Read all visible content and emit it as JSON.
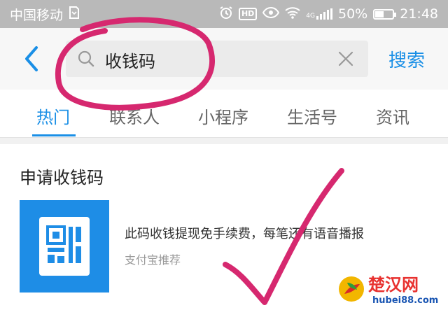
{
  "status_bar": {
    "carrier": "中国移动",
    "battery_percent": "50%",
    "battery_level": 0.5,
    "time": "21:48",
    "hd_badge": "HD",
    "network": "4G"
  },
  "header": {
    "search_value": "收钱码",
    "search_button_label": "搜索"
  },
  "tabs": [
    {
      "label": "热门"
    },
    {
      "label": "联系人"
    },
    {
      "label": "小程序"
    },
    {
      "label": "生活号"
    },
    {
      "label": "资讯"
    }
  ],
  "result": {
    "section_title": "申请收钱码",
    "description": "此码收钱提现免手续费，每笔还有语音播报",
    "source": "支付宝推荐"
  },
  "watermark": {
    "name": "楚汉网",
    "url": "hubei88.com"
  },
  "colors": {
    "accent": "#1a8fe6",
    "annotation": "#d6286f",
    "tile": "#1e8de6"
  }
}
